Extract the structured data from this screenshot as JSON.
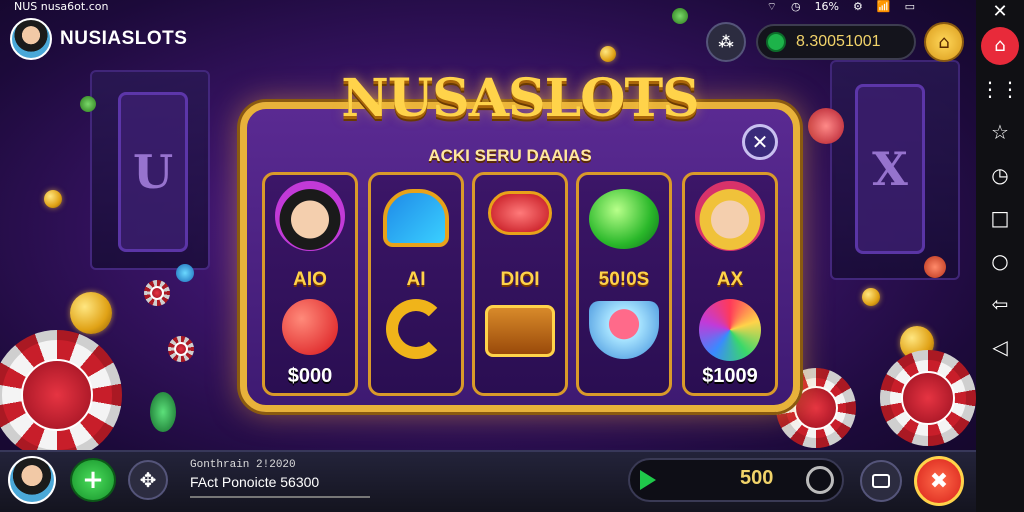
{
  "status_bar": {
    "left_text": "NUS nusa6ot.con",
    "right_text": "16%"
  },
  "header": {
    "brand_name": "NUSIASLOTS",
    "balance": "8.30051001"
  },
  "panel": {
    "title": "NUSASLOTS",
    "subtitle": "ACKI SERU DAAIAS",
    "reels": [
      {
        "label": "AIO",
        "value": "$000"
      },
      {
        "label": "AI",
        "value": ""
      },
      {
        "label": "DIOI",
        "value": ""
      },
      {
        "label": "50!0S",
        "value": ""
      },
      {
        "label": "AX",
        "value": "$1009"
      }
    ]
  },
  "bottom": {
    "info_line1": "Gonthrain 2!2020",
    "info_line2": "FAct Ponoicte 56300",
    "bet_value": "500"
  },
  "nav_rail": [
    "home-icon",
    "grid-icon",
    "star-icon",
    "clock-icon",
    "square-icon",
    "circle-icon",
    "share-icon",
    "back-icon"
  ]
}
